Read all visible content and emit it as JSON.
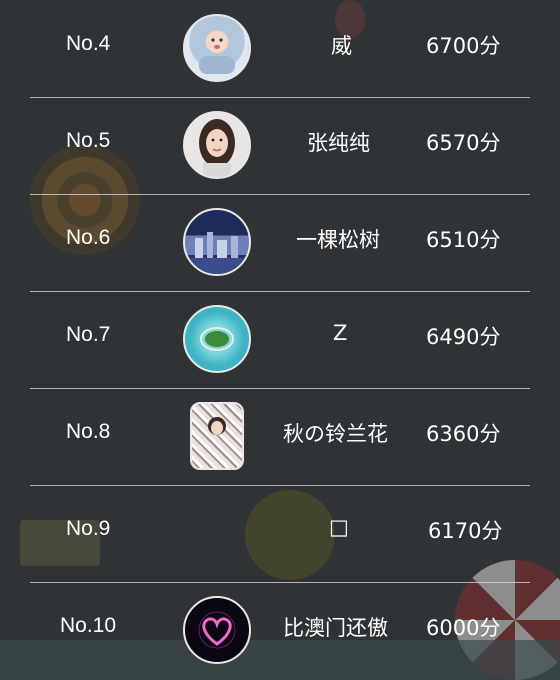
{
  "rows": [
    {
      "rank": "No.4",
      "name": "威",
      "score": "6700分",
      "avatar_icon": "baby-photo-avatar-icon",
      "avatar_colors": [
        "#dfe8f2",
        "#b3c7dc",
        "#f0d2c0"
      ]
    },
    {
      "rank": "No.5",
      "name": "张纯纯",
      "score": "6570分",
      "avatar_icon": "woman-portrait-avatar-icon",
      "avatar_colors": [
        "#e8e6e4",
        "#3a2a22",
        "#f1d4c4"
      ]
    },
    {
      "rank": "No.6",
      "name": "一棵松树",
      "score": "6510分",
      "avatar_icon": "night-city-avatar-icon",
      "avatar_colors": [
        "#1e2a5a",
        "#6f7fb8",
        "#c9d1e8"
      ]
    },
    {
      "rank": "No.7",
      "name": "Z",
      "score": "6490分",
      "avatar_icon": "island-avatar-icon",
      "avatar_colors": [
        "#3fb4c4",
        "#7ed8e0",
        "#3a8a3a"
      ]
    },
    {
      "rank": "No.8",
      "name": "秋の铃兰花",
      "score": "6360分",
      "avatar_icon": "floral-pattern-avatar-icon",
      "avatar_colors": [
        "#e8e2de",
        "#a08c86",
        "#ffffff"
      ]
    },
    {
      "rank": "No.9",
      "name": "□",
      "score": "6170分",
      "avatar_icon": "",
      "avatar_colors": []
    },
    {
      "rank": "No.10",
      "name": "比澳门还傲",
      "score": "6000分",
      "avatar_icon": "glowing-heart-avatar-icon",
      "avatar_colors": [
        "#0a0612",
        "#c23ab8",
        "#f06ad0"
      ]
    }
  ]
}
